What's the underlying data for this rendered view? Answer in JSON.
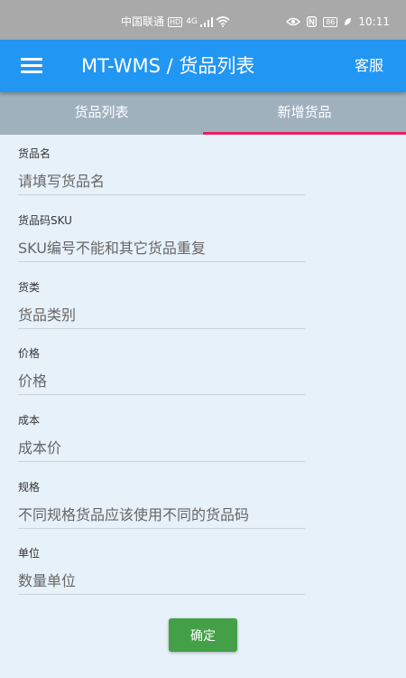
{
  "status_bar": {
    "carrier": "中国联通",
    "carrier_badge": "HD",
    "signal_text": "4G",
    "battery": "86",
    "time": "10:11",
    "icons": [
      "signal-icon",
      "wifi-icon",
      "eye-icon",
      "nfc-icon",
      "battery-icon",
      "leaf-icon"
    ]
  },
  "app_bar": {
    "title": "MT-WMS / 货品列表",
    "service_label": "客服",
    "color": "#2196f3"
  },
  "tabs": [
    {
      "label": "货品列表",
      "selected": false
    },
    {
      "label": "新增货品",
      "selected": true
    }
  ],
  "form": {
    "fields": [
      {
        "label": "货品名",
        "placeholder": "请填写货品名"
      },
      {
        "label": "货品码SKU",
        "placeholder": "SKU编号不能和其它货品重复"
      },
      {
        "label": "货类",
        "placeholder": "货品类别"
      },
      {
        "label": "价格",
        "placeholder": "价格"
      },
      {
        "label": "成本",
        "placeholder": "成本价"
      },
      {
        "label": "规格",
        "placeholder": "不同规格货品应该使用不同的货品码"
      },
      {
        "label": "单位",
        "placeholder": "数量单位"
      }
    ],
    "confirm_label": "确定",
    "confirm_color": "#43a047"
  },
  "colors": {
    "background": "#e7f1fa",
    "tab_bar": "#9fb1bd",
    "tab_indicator": "#e91e63"
  }
}
